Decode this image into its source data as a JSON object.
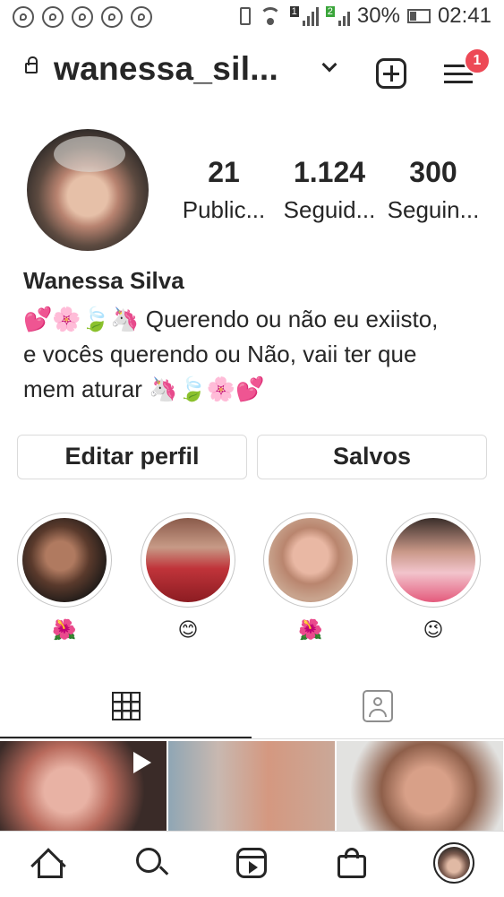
{
  "status_bar": {
    "notification_icons": [
      "whatsapp-icon",
      "whatsapp-icon",
      "whatsapp-icon",
      "whatsapp-icon",
      "whatsapp-icon"
    ],
    "sim1_badge": "1",
    "sim2_badge": "2",
    "battery": "30%",
    "time": "02:41"
  },
  "header": {
    "username": "wanessa_sil...",
    "notification_count": "1"
  },
  "profile": {
    "stats": [
      {
        "value": "21",
        "label": "Public..."
      },
      {
        "value": "1.124",
        "label": "Seguid..."
      },
      {
        "value": "300",
        "label": "Seguin..."
      }
    ],
    "full_name": "Wanessa Silva",
    "bio_lines": [
      "💕🌸🍃🦄 Querendo ou não eu exiisto,",
      "e vocês querendo ou Não, vaii ter que",
      "mem aturar 🦄🍃🌸💕"
    ]
  },
  "buttons": {
    "edit_profile": "Editar perfil",
    "saved": "Salvos"
  },
  "highlights": [
    {
      "label": "🌺"
    },
    {
      "label": "😊"
    },
    {
      "label": "🌺"
    },
    {
      "label": "😉"
    }
  ],
  "colors": {
    "badge_red": "#ed4956",
    "text": "#262626",
    "divider": "#dbdbdb",
    "inactive_icon": "#8e8e8e"
  }
}
